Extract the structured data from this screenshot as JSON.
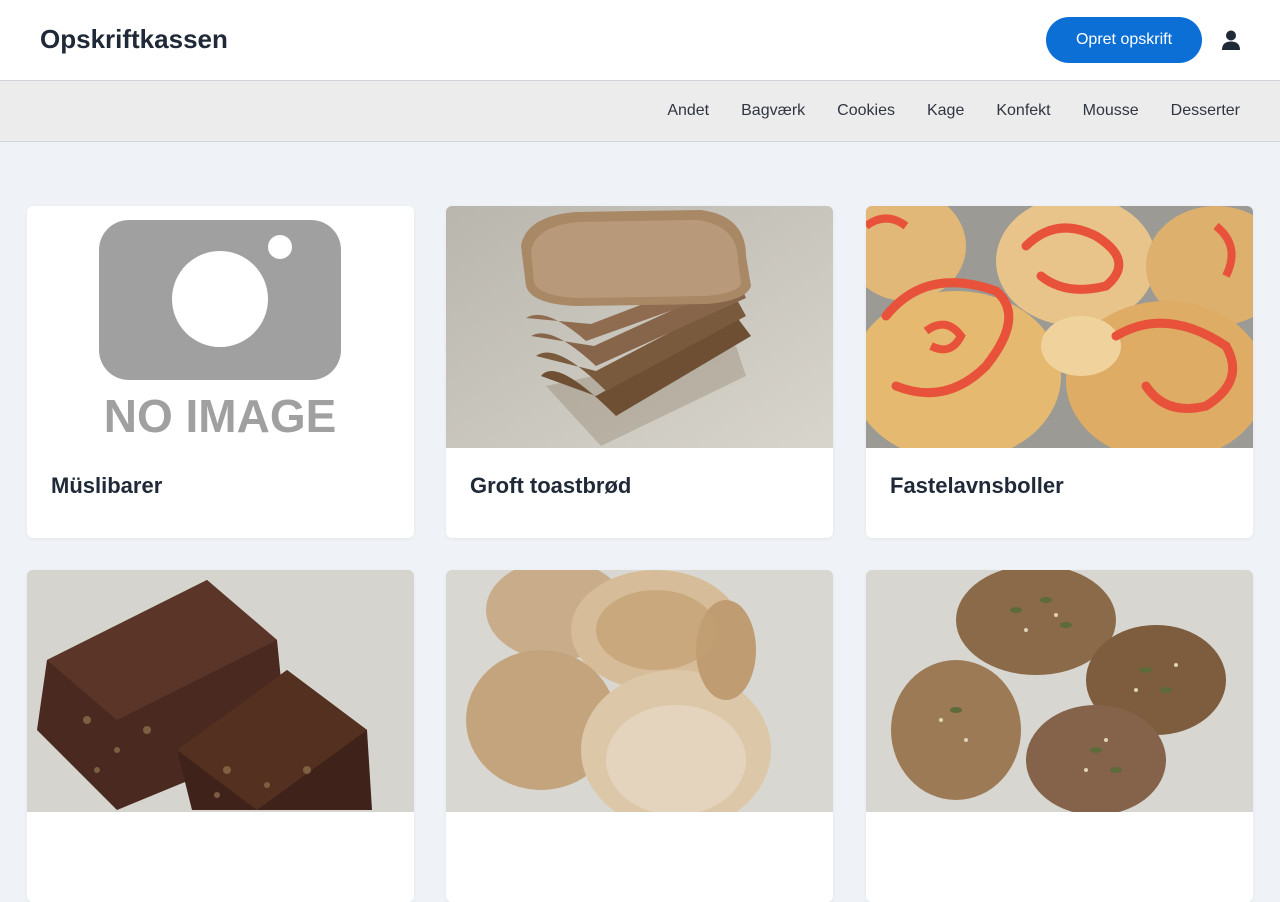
{
  "header": {
    "brand": "Opskriftkassen",
    "create_label": "Opret opskrift",
    "user_icon": "user-icon"
  },
  "nav": {
    "items": [
      "Andet",
      "Bagværk",
      "Cookies",
      "Kage",
      "Konfekt",
      "Mousse",
      "Desserter"
    ]
  },
  "recipes": [
    {
      "title": "Müslibarer",
      "image": "no-image-placeholder",
      "placeholder_text": "NO IMAGE"
    },
    {
      "title": "Groft toastbrød",
      "image": "sliced-toast-bread"
    },
    {
      "title": "Fastelavnsboller",
      "image": "fastelavn-buns-red-icing"
    },
    {
      "title": "",
      "image": "dark-rye-bread"
    },
    {
      "title": "",
      "image": "white-bread-rolls"
    },
    {
      "title": "",
      "image": "seeded-bread-rolls"
    }
  ],
  "colors": {
    "accent": "#0b6fd6",
    "page_bg": "#eff3f7",
    "nav_bg": "#ececec",
    "card_bg": "#ffffff"
  }
}
